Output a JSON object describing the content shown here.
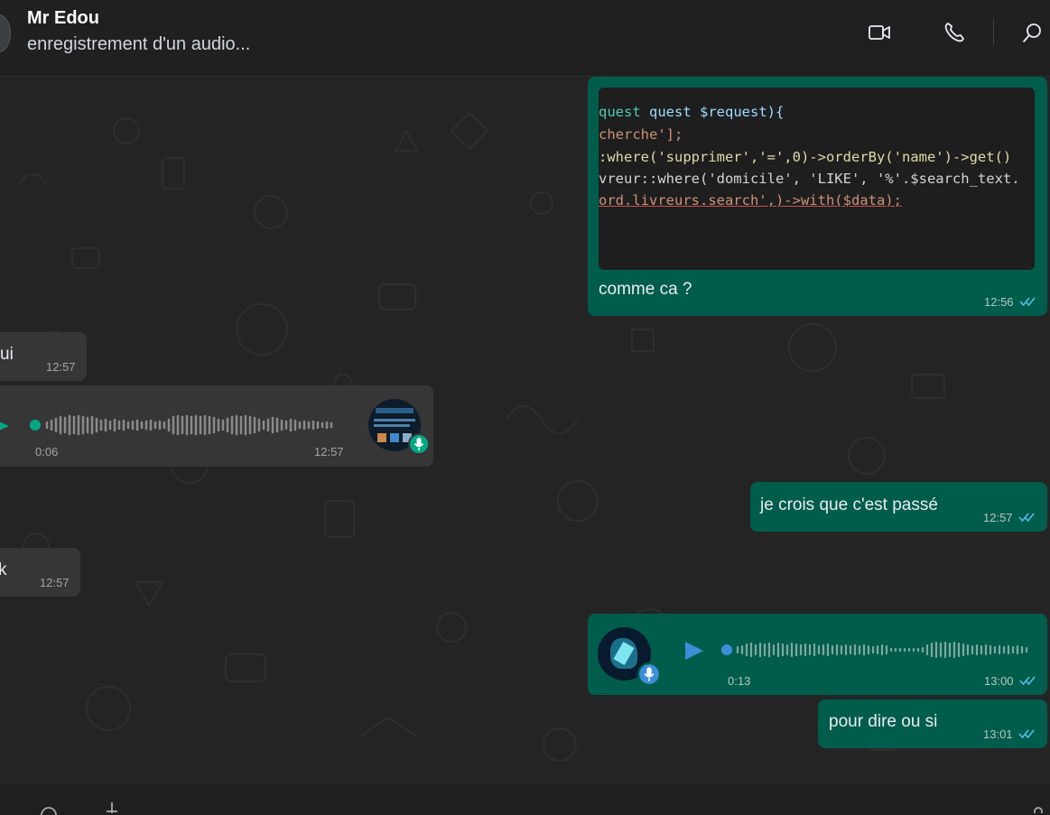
{
  "header": {
    "contact_name": "Mr Edou",
    "status": "enregistrement d'un audio...",
    "icons": [
      "video-call-icon",
      "voice-call-icon",
      "search-icon"
    ]
  },
  "messages": {
    "code_screenshot": {
      "lines": [
        "quest $request){",
        "cherche'];",
        ":where('supprimer','=',0)->orderBy('name')->get()",
        "vreur::where('domicile', 'LIKE', '%'.$search_text.",
        "ord.livreurs.search',)->with($data);"
      ],
      "caption": "comme ca ?",
      "time": "12:56"
    },
    "in_text_1": {
      "text": "ui",
      "time": "12:57"
    },
    "in_voice": {
      "duration": "0:06",
      "time": "12:57",
      "progress": 0
    },
    "out_text_1": {
      "text": "je crois que c'est passé",
      "time": "12:57"
    },
    "in_text_2": {
      "text": "k",
      "time": "12:57"
    },
    "out_voice": {
      "duration": "0:13",
      "time": "13:00",
      "progress": 0
    },
    "out_text_2": {
      "text": "pour dire ou si",
      "time": "13:01"
    }
  },
  "colors": {
    "outgoing_bubble": "#005c4b",
    "incoming_bubble": "#363636",
    "read_ticks": "#53bdeb",
    "accent_green": "#00a884"
  }
}
